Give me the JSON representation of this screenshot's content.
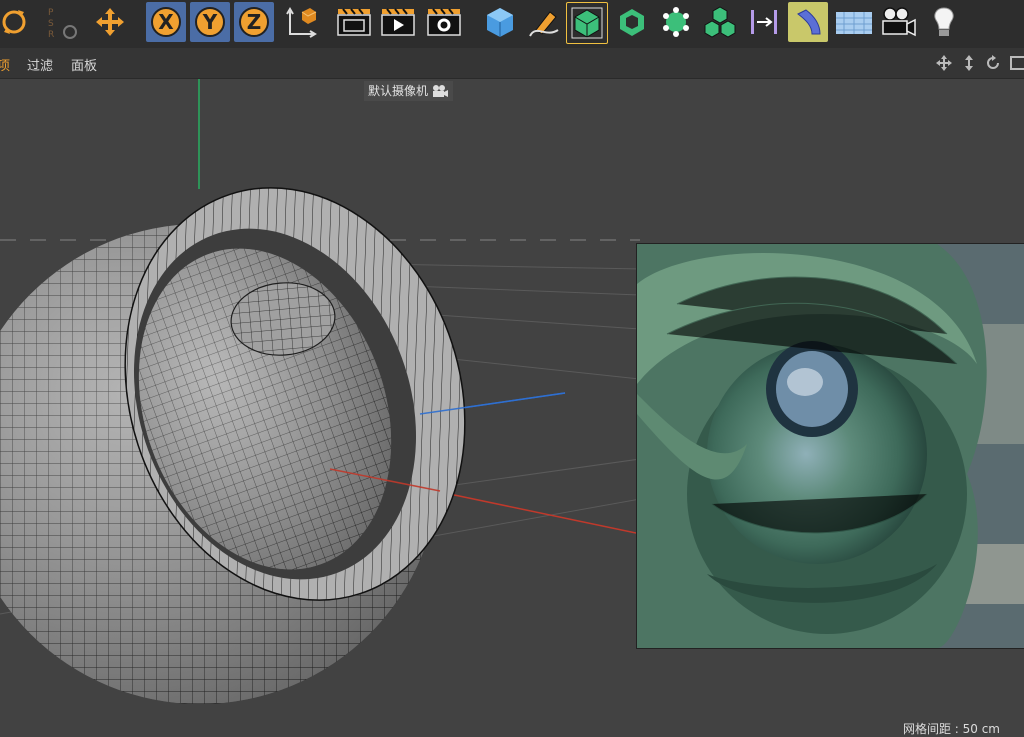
{
  "menubar": {
    "items": [
      {
        "label": "项",
        "active": true
      },
      {
        "label": "过滤",
        "active": false
      },
      {
        "label": "面板",
        "active": false
      }
    ]
  },
  "viewport": {
    "camera_label": "默认摄像机",
    "grid_spacing": "网格间距 : 50 cm"
  },
  "toolbar": {
    "tools": [
      "rotate-icon",
      "psr-icon",
      "move-icon",
      "x-axis-icon",
      "y-axis-icon",
      "z-axis-icon",
      "coordinate-system-icon",
      "render-view-icon",
      "render-picture-viewer-icon",
      "render-settings-icon",
      "cube-icon",
      "pen-icon",
      "subdivision-icon",
      "extrude-icon",
      "mograph-icon",
      "cloner-icon",
      "deformer-icon",
      "bend-icon",
      "floor-icon",
      "camera-icon",
      "light-icon"
    ]
  },
  "colors": {
    "accent": "#f0a030",
    "axis_x": "#c0392b",
    "axis_y": "#27ae60",
    "axis_z": "#2e6fd1",
    "selected_tool_bg": "#4b6da6"
  }
}
